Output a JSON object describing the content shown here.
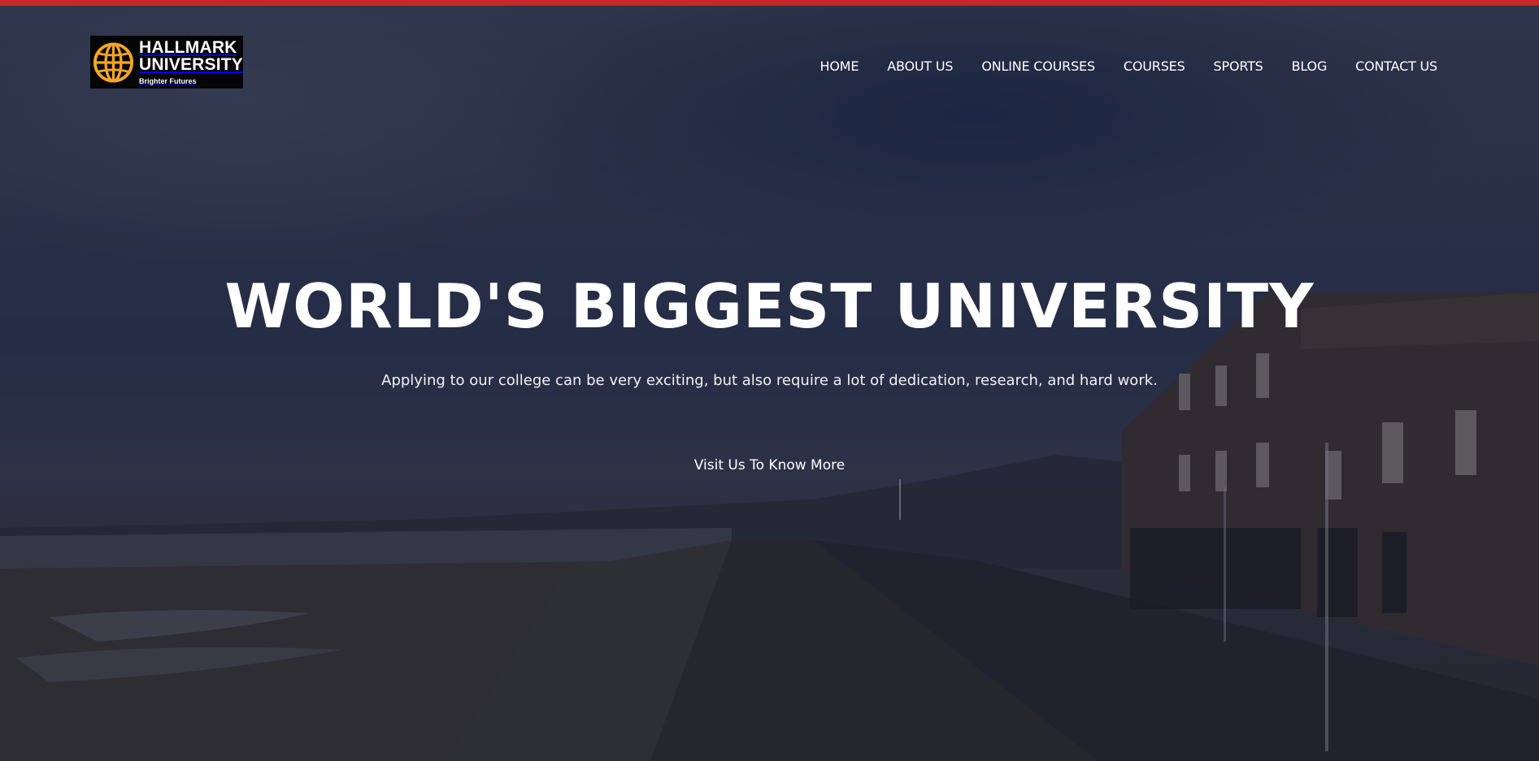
{
  "header": {
    "logo": {
      "brand_line_1": "HALLMARK",
      "brand_line_2": "UNIVERSITY",
      "tagline": "Brighter Futures",
      "icon": "globe-icon",
      "icon_color": "#f5a623"
    },
    "nav": {
      "items": [
        {
          "label": "HOME"
        },
        {
          "label": "ABOUT US"
        },
        {
          "label": "ONLINE COURSES"
        },
        {
          "label": "COURSES"
        },
        {
          "label": "SPORTS"
        },
        {
          "label": "BLOG"
        },
        {
          "label": "CONTACT US"
        }
      ]
    }
  },
  "hero": {
    "title": "WORLD'S BIGGEST UNIVERSITY",
    "subtitle": "Applying to our college can be very exciting, but also require a lot of dedication, research, and hard work.",
    "cta_label": "Visit Us To Know More"
  },
  "colors": {
    "accent_stripe": "#c22a2a",
    "overlay": "#161c34",
    "text": "#ffffff"
  }
}
